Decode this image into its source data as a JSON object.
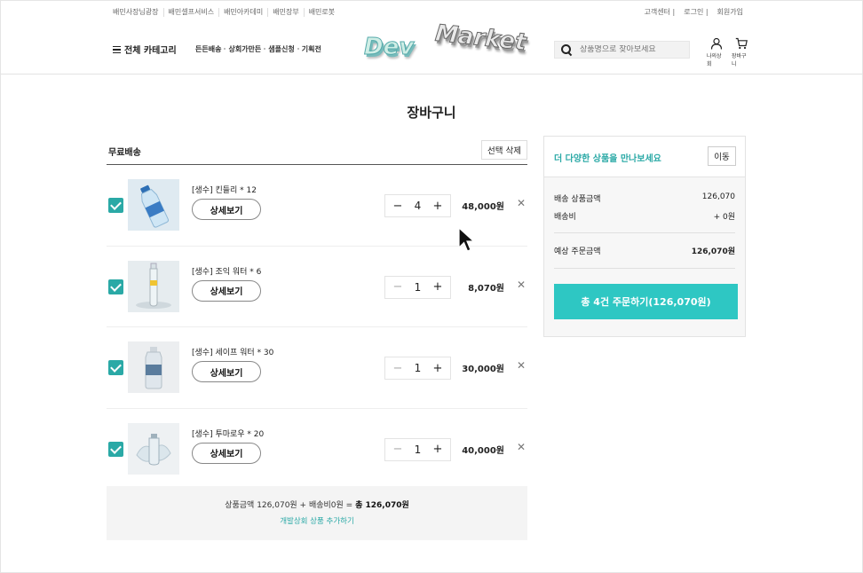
{
  "util": {
    "left": [
      "배민사장님광장",
      "배민셀프서비스",
      "배민아카데미",
      "배민장부",
      "배민로봇"
    ],
    "right": [
      "고객센터 |",
      "로그인 |",
      "회원가입"
    ]
  },
  "header": {
    "category_label": "전체 카테고리",
    "gnb": [
      "든든배송",
      "상회가만든",
      "샘플신청",
      "기획전"
    ],
    "logo_left": "Dev",
    "logo_right": "Market",
    "search_placeholder": "상품명으로 찾아보세요",
    "my_label": "나의상회",
    "cart_label": "장바구니"
  },
  "page": {
    "title": "장바구니"
  },
  "cart": {
    "section_label": "무료배송",
    "delete_selected": "선택 삭제",
    "detail_label": "상세보기",
    "items": [
      {
        "name": "[생수] 킨들리 * 12",
        "qty": "4",
        "price": "48,000원",
        "checked": true
      },
      {
        "name": "[생수] 조익 워터 * 6",
        "qty": "1",
        "price": "8,070원",
        "checked": true
      },
      {
        "name": "[생수] 세이프 워터 * 30",
        "qty": "1",
        "price": "30,000원",
        "checked": true
      },
      {
        "name": "[생수] 투마로우 * 20",
        "qty": "1",
        "price": "40,000원",
        "checked": true
      }
    ],
    "summary_text": "상품금액 126,070원 + 배송비0원 = ",
    "summary_total": "총 126,070원",
    "add_more": "개발상회 상품 추가하기"
  },
  "side": {
    "promo": "더 다양한 상품을 만나보세요",
    "move": "이동",
    "goods_label": "배송 상품금액",
    "goods_value": "126,070",
    "ship_label": "배송비",
    "ship_value": "+ 0원",
    "expected_label": "예상 주문금액",
    "expected_value": "126,070원",
    "order_button": "총 4건 주문하기(126,070원)"
  },
  "colors": {
    "accent": "#2aa9a6",
    "order_button": "#2ec7c3"
  }
}
